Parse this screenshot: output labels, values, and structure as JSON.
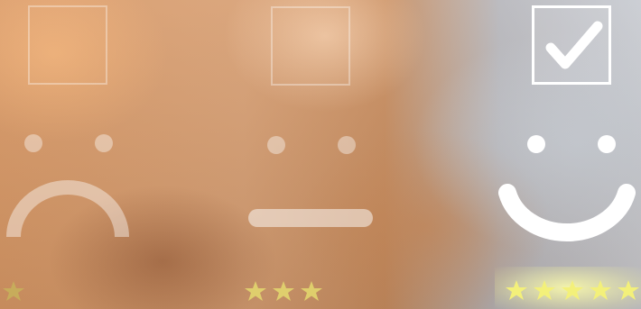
{
  "scene": {
    "description_icon_names": [
      "checkbox-icon",
      "checkmark-icon",
      "sad-face-icon",
      "neutral-face-icon",
      "happy-face-icon",
      "star-icon"
    ]
  },
  "ratings": [
    {
      "mood": "sad",
      "stars": 1,
      "checked": false
    },
    {
      "mood": "neutral",
      "stars": 3,
      "checked": false
    },
    {
      "mood": "happy",
      "stars": 5,
      "checked": true
    }
  ],
  "colors": {
    "star": "#e8e27a",
    "star_bright": "#f3f07a",
    "face_dim": "rgba(255,255,255,0.4)",
    "face_bright": "#ffffff"
  }
}
